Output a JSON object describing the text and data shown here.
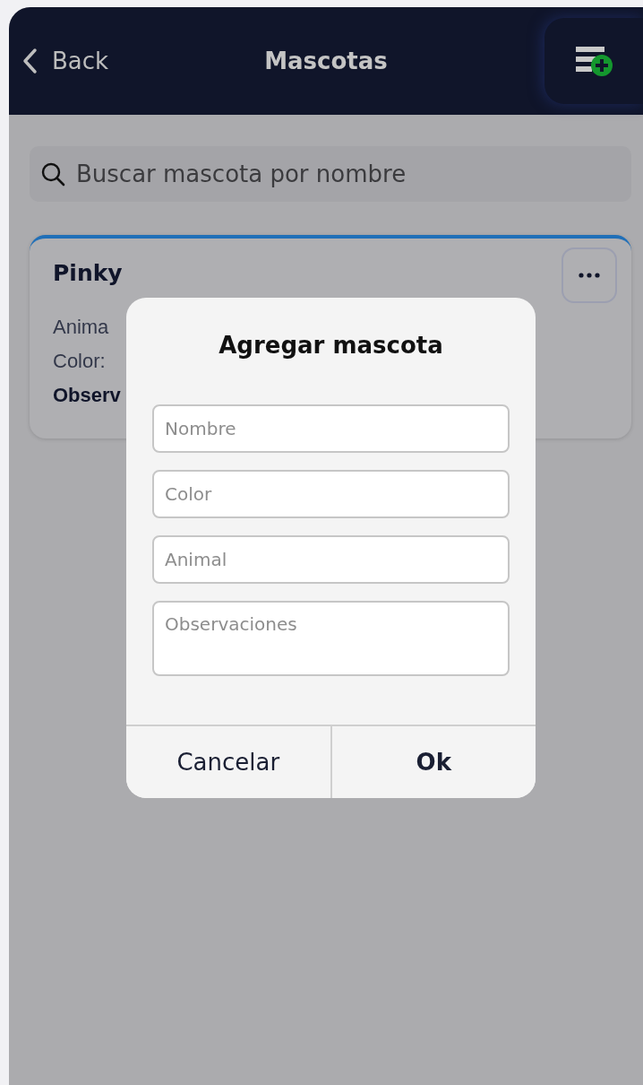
{
  "header": {
    "back_label": "Back",
    "title": "Mascotas"
  },
  "search": {
    "placeholder": "Buscar mascota por nombre"
  },
  "pets": [
    {
      "name": "Pinky",
      "lines": [
        {
          "text": "Anima",
          "kind": "plain"
        },
        {
          "text": "Color:",
          "kind": "plain"
        },
        {
          "text": "Observ",
          "kind": "bold"
        }
      ]
    }
  ],
  "dialog": {
    "title": "Agregar mascota",
    "fields": [
      {
        "placeholder": "Nombre",
        "kind": "input"
      },
      {
        "placeholder": "Color",
        "kind": "input"
      },
      {
        "placeholder": "Animal",
        "kind": "input"
      },
      {
        "placeholder": "Observaciones",
        "kind": "textarea"
      }
    ],
    "buttons": [
      {
        "label": "Cancelar",
        "kind": "cancel"
      },
      {
        "label": "Ok",
        "kind": "confirm"
      }
    ]
  }
}
